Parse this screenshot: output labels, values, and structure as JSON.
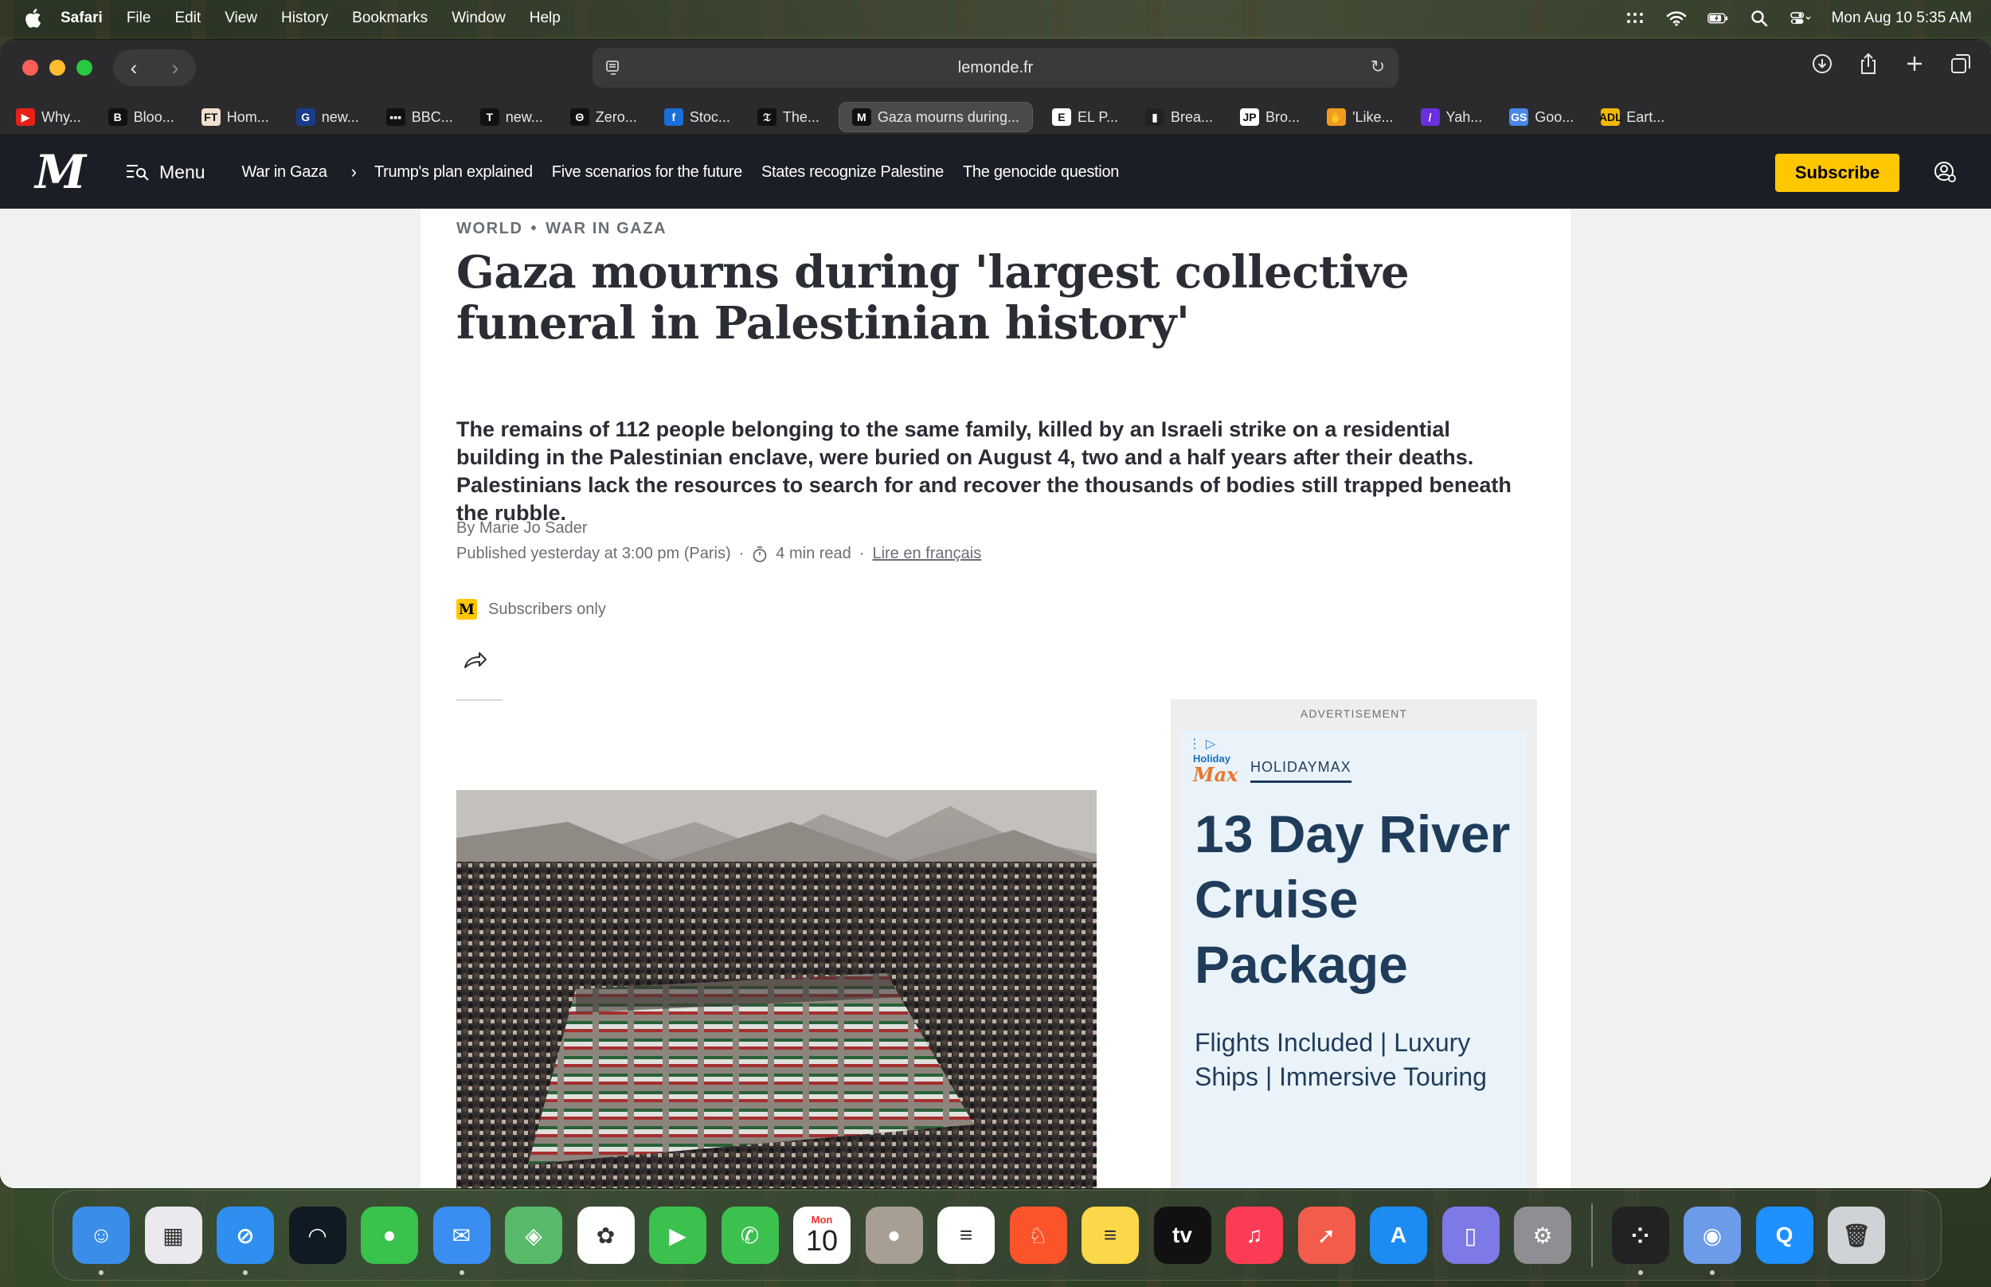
{
  "menubar": {
    "app_name": "Safari",
    "items": [
      "File",
      "Edit",
      "View",
      "History",
      "Bookmarks",
      "Window",
      "Help"
    ],
    "clock": "Mon Aug 10  5:35 AM"
  },
  "browser": {
    "url": "lemonde.fr",
    "tabs": [
      {
        "label": "Why...",
        "fav": "▶",
        "color": "#e62117"
      },
      {
        "label": "Bloo...",
        "fav": "B",
        "color": "#111111"
      },
      {
        "label": "Hom...",
        "fav": "FT",
        "color": "#f2dfce"
      },
      {
        "label": "new...",
        "fav": "G",
        "color": "#1a3a8a"
      },
      {
        "label": "BBC...",
        "fav": "▪▪▪",
        "color": "#111111"
      },
      {
        "label": "new...",
        "fav": "T",
        "color": "#111111"
      },
      {
        "label": "Zero...",
        "fav": "Θ",
        "color": "#111111"
      },
      {
        "label": "Stoc...",
        "fav": "f",
        "color": "#1a6ed8"
      },
      {
        "label": "The...",
        "fav": "𝔗",
        "color": "#111111"
      },
      {
        "label": "Gaza mourns during...",
        "fav": "M",
        "color": "#111111",
        "active": true
      },
      {
        "label": "EL P...",
        "fav": "E",
        "color": "#ffffff"
      },
      {
        "label": "Brea...",
        "fav": "▮",
        "color": "#222222"
      },
      {
        "label": "Bro...",
        "fav": "JP",
        "color": "#ffffff"
      },
      {
        "label": "'Like...",
        "fav": "✋",
        "color": "#f29a1f"
      },
      {
        "label": "Yah...",
        "fav": "/",
        "color": "#6b2fe0"
      },
      {
        "label": "Goo...",
        "fav": "GS",
        "color": "#4a86e8"
      },
      {
        "label": "Eart...",
        "fav": "ADL",
        "color": "#f2b800"
      }
    ]
  },
  "lemonde_nav": {
    "menu_label": "Menu",
    "section": "War in Gaza",
    "links": [
      "Trump's plan explained",
      "Five scenarios for the future",
      "States recognize Palestine",
      "The genocide question"
    ],
    "subscribe_label": "Subscribe"
  },
  "article": {
    "kicker_section": "WORLD",
    "kicker_subsection": "WAR IN GAZA",
    "headline": "Gaza mourns during 'largest collective funeral in Palestinian history'",
    "standfirst": "The remains of 112 people belonging to the same family, killed by an Israeli strike on a residential building in the Palestinian enclave, were buried on August 4, two and a half years after their deaths. Palestinians lack the resources to search for and recover the thousands of bodies still trapped beneath the rubble.",
    "byline": "By Marie Jo Sader",
    "published": "Published yesterday at 3:00 pm (Paris)",
    "read_time": "4 min read",
    "lire": "Lire en français",
    "subscribers_only": "Subscribers only"
  },
  "ad": {
    "label": "ADVERTISEMENT",
    "logo_line1": "Holiday",
    "logo_line2": "Max",
    "brand": "HOLIDAYMAX",
    "title": "13 Day River Cruise Package",
    "subtitle": "Flights Included | Luxury Ships | Immersive Touring"
  },
  "dock": {
    "apps": [
      {
        "name": "finder",
        "bg": "#3b8ee8",
        "glyph": "☺",
        "running": true
      },
      {
        "name": "launchpad",
        "bg": "#e9e9ee",
        "glyph": "▦",
        "running": false
      },
      {
        "name": "safari",
        "bg": "#2e8ff0",
        "glyph": "⊘",
        "running": true
      },
      {
        "name": "podcasts-like",
        "bg": "#0f1a22",
        "glyph": "◠",
        "running": false
      },
      {
        "name": "messages",
        "bg": "#39c24c",
        "glyph": "●",
        "running": false
      },
      {
        "name": "mail",
        "bg": "#3a8ef2",
        "glyph": "✉",
        "running": true
      },
      {
        "name": "maps",
        "bg": "#59b96b",
        "glyph": "◈",
        "running": false
      },
      {
        "name": "photos",
        "bg": "#ffffff",
        "glyph": "✿",
        "running": false
      },
      {
        "name": "facetime",
        "bg": "#3cc14e",
        "glyph": "▶",
        "running": false
      },
      {
        "name": "phone",
        "bg": "#3cc14e",
        "glyph": "✆",
        "running": false
      },
      {
        "name": "calendar",
        "bg": "#ffffff",
        "glyph": "10",
        "running": false
      },
      {
        "name": "contacts",
        "bg": "#a89f94",
        "glyph": "●",
        "running": false
      },
      {
        "name": "reminders",
        "bg": "#ffffff",
        "glyph": "≡",
        "running": false
      },
      {
        "name": "brave",
        "bg": "#fb542b",
        "glyph": "♘",
        "running": false
      },
      {
        "name": "notes",
        "bg": "#fbd74a",
        "glyph": "≡",
        "running": false
      },
      {
        "name": "apple-tv",
        "bg": "#111111",
        "glyph": "tv",
        "running": false
      },
      {
        "name": "music",
        "bg": "#fb3c54",
        "glyph": "♫",
        "running": false
      },
      {
        "name": "rocket",
        "bg": "#f25c4b",
        "glyph": "➚",
        "running": false
      },
      {
        "name": "app-store",
        "bg": "#1c8cf2",
        "glyph": "A",
        "running": false
      },
      {
        "name": "iphone-mirroring",
        "bg": "#7d79e6",
        "glyph": "▯",
        "running": false
      },
      {
        "name": "system-settings",
        "bg": "#8e8e93",
        "glyph": "⚙",
        "running": false
      }
    ],
    "apps_right": [
      {
        "name": "app-grid",
        "bg": "#222222",
        "glyph": "⁘",
        "running": true
      },
      {
        "name": "disk-utility",
        "bg": "#6c9be8",
        "glyph": "◉",
        "running": true
      },
      {
        "name": "quickq",
        "bg": "#1e90ff",
        "glyph": "Q",
        "running": false
      },
      {
        "name": "trash",
        "bg": "#cfd3d6",
        "glyph": "🗑",
        "running": false
      }
    ],
    "calendar_month": "Mon"
  }
}
